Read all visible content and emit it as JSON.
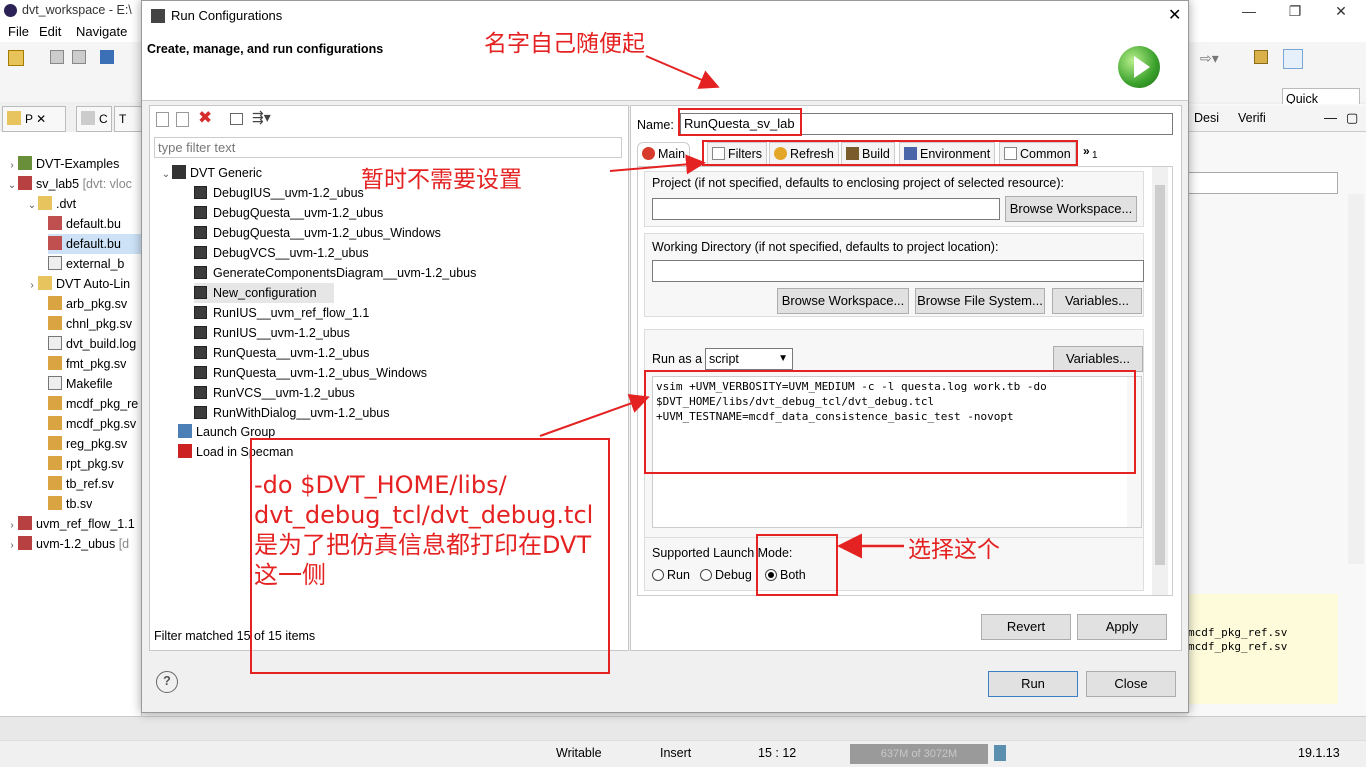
{
  "ide": {
    "title": "dvt_workspace - E:\\",
    "menu": [
      "File",
      "Edit",
      "Navigate"
    ],
    "quick_access": "Quick Access",
    "right_tabs": [
      "Desi",
      "Verifi"
    ],
    "console_lines": [
      "mcdf_pkg_ref.sv",
      "mcdf_pkg_ref.sv"
    ],
    "left_tabs": [
      "P",
      "C",
      "T"
    ],
    "tree": [
      {
        "label": "DVT-Examples",
        "icon": "project-icon"
      },
      {
        "label": "sv_lab5",
        "suffix": "[dvt: vloc",
        "icon": "project-icon"
      },
      {
        "label": ".dvt",
        "icon": "folder-icon"
      },
      {
        "label": "default.bu",
        "icon": "file-icon"
      },
      {
        "label": "default.bu",
        "icon": "file-icon"
      },
      {
        "label": "external_b",
        "icon": "file-icon"
      },
      {
        "label": "DVT Auto-Lin",
        "icon": "folder-icon"
      },
      {
        "label": "arb_pkg.sv",
        "icon": "sv-file-icon"
      },
      {
        "label": "chnl_pkg.sv",
        "icon": "sv-file-icon"
      },
      {
        "label": "dvt_build.log",
        "icon": "file-icon"
      },
      {
        "label": "fmt_pkg.sv",
        "icon": "sv-file-icon"
      },
      {
        "label": "Makefile",
        "icon": "file-icon"
      },
      {
        "label": "mcdf_pkg_re",
        "icon": "sv-file-icon"
      },
      {
        "label": "mcdf_pkg.sv",
        "icon": "sv-file-icon"
      },
      {
        "label": "reg_pkg.sv",
        "icon": "sv-file-icon"
      },
      {
        "label": "rpt_pkg.sv",
        "icon": "sv-file-icon"
      },
      {
        "label": "tb_ref.sv",
        "icon": "sv-file-icon"
      },
      {
        "label": "tb.sv",
        "icon": "sv-file-icon"
      },
      {
        "label": "uvm_ref_flow_1.1",
        "icon": "project-icon"
      },
      {
        "label": "uvm-1.2_ubus",
        "suffix": "[d",
        "icon": "project-icon"
      }
    ],
    "status": {
      "writable": "Writable",
      "insert": "Insert",
      "position": "15 : 12",
      "memory": "637M of 3072M",
      "version": "19.1.13"
    }
  },
  "dialog": {
    "title": "Run Configurations",
    "subtitle": "Create, manage, and run configurations",
    "filter_placeholder": "type filter text",
    "category": "DVT Generic",
    "configs": [
      "DebugIUS__uvm-1.2_ubus",
      "DebugQuesta__uvm-1.2_ubus",
      "DebugQuesta__uvm-1.2_ubus_Windows",
      "DebugVCS__uvm-1.2_ubus",
      "GenerateComponentsDiagram__uvm-1.2_ubus",
      "New_configuration",
      "RunIUS__uvm_ref_flow_1.1",
      "RunIUS__uvm-1.2_ubus",
      "RunQuesta__uvm-1.2_ubus",
      "RunQuesta__uvm-1.2_ubus_Windows",
      "RunVCS__uvm-1.2_ubus",
      "RunWithDialog__uvm-1.2_ubus"
    ],
    "launch_group": "Launch Group",
    "load_specman": "Load in Specman",
    "filter_status": "Filter matched 15 of 15 items",
    "name_label": "Name:",
    "name_value": "RunQuesta_sv_lab",
    "tabs": [
      "Main",
      "Filters",
      "Refresh",
      "Build",
      "Environment",
      "Common"
    ],
    "tabs_overflow": "1",
    "project_label": "Project (if not specified, defaults to enclosing project of selected resource):",
    "browse_workspace": "Browse Workspace...",
    "workdir_label": "Working Directory (if not specified, defaults to project location):",
    "browse_file_system": "Browse File System...",
    "variables": "Variables...",
    "run_as_label": "Run as a",
    "run_as_value": "script",
    "script_lines": [
      "vsim +UVM_VERBOSITY=UVM_MEDIUM -c -l questa.log work.tb -do",
      "$DVT_HOME/libs/dvt_debug_tcl/dvt_debug.tcl",
      "+UVM_TESTNAME=mcdf_data_consistence_basic_test -novopt"
    ],
    "launch_mode_label": "Supported Launch Mode:",
    "modes": [
      "Run",
      "Debug",
      "Both"
    ],
    "selected_mode": "Both",
    "revert": "Revert",
    "apply": "Apply",
    "run": "Run",
    "close": "Close"
  },
  "annotations": {
    "name_hint": "名字自己随便起",
    "tabs_hint": "暂时不需要设置",
    "script_note": [
      "-do $DVT_HOME/libs/",
      "dvt_debug_tcl/dvt_debug.tcl",
      "是为了把仿真信息都打印在DVT",
      "这一侧"
    ],
    "mode_hint": "选择这个",
    "color": "#e52222"
  }
}
